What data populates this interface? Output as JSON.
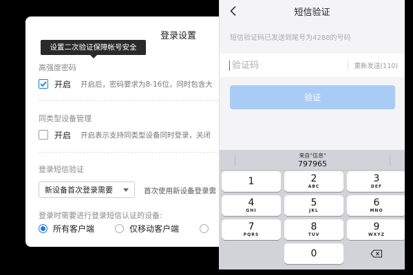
{
  "settings": {
    "title": "登录设置",
    "tooltip": "设置二次验证保障帐号安全",
    "strong_password": {
      "section_label": "高强度密码",
      "option_label": "开启",
      "checked": true,
      "description": "开启后，密码要求为8-16位，同时包含大"
    },
    "device_management": {
      "section_label": "同类型设备管理",
      "option_label": "开启",
      "checked": false,
      "description": "开启表示支持同类型设备同时登录，关闭"
    },
    "sms_login": {
      "section_label": "登录短信验证",
      "select_value": "新设备首次登录需要",
      "select_hint": "首次使用新设备登录需",
      "devices_label": "登录时需要进行登录短信认证的设备:",
      "radio_options": [
        {
          "label": "所有客户端",
          "selected": true
        },
        {
          "label": "仅移动客户端",
          "selected": false
        }
      ]
    }
  },
  "phone": {
    "title": "短信验证",
    "info": "短信验证码已发送到尾号为4288的号码",
    "input_placeholder": "验证码",
    "resend_label": "重新发送(110)",
    "verify_label": "验证",
    "accent_color": "#1677ff",
    "keyboard": {
      "suggestion_source": "来自\"信息\"",
      "suggestion_code": "797965",
      "keys": [
        {
          "num": "1",
          "sub": ""
        },
        {
          "num": "2",
          "sub": "ABC"
        },
        {
          "num": "3",
          "sub": "DEF"
        },
        {
          "num": "4",
          "sub": "GHI"
        },
        {
          "num": "5",
          "sub": "JKL"
        },
        {
          "num": "6",
          "sub": "MNO"
        },
        {
          "num": "7",
          "sub": "PQRS"
        },
        {
          "num": "8",
          "sub": "TUV"
        },
        {
          "num": "9",
          "sub": "WXYZ"
        },
        {
          "num": "0",
          "sub": ""
        }
      ],
      "delete_icon": "backspace-icon"
    }
  }
}
